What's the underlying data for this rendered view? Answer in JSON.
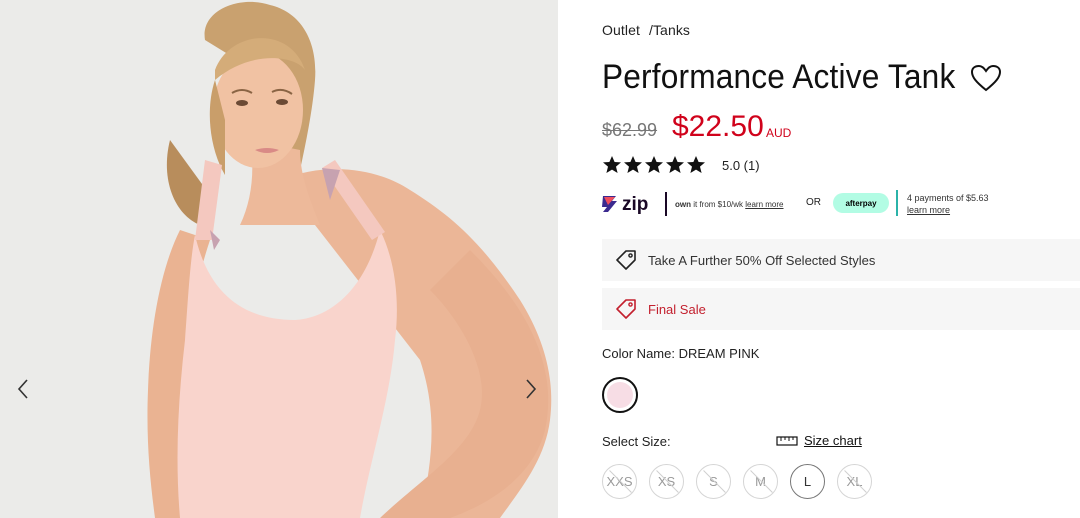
{
  "breadcrumb": {
    "category": "Outlet",
    "separator": "/",
    "subcategory": "Tanks"
  },
  "product": {
    "title": "Performance Active Tank",
    "original_price": "$62.99",
    "sale_price": "$22.50",
    "currency": "AUD",
    "rating_text": "5.0 (1)",
    "stars": 5
  },
  "payments": {
    "zip": {
      "logo": "zip",
      "text_bold": "own",
      "text": " it from $10/wk ",
      "link": "learn more"
    },
    "or": "OR",
    "afterpay": {
      "logo": "afterpay",
      "line1": "4 payments of $5.63",
      "link": "learn more"
    }
  },
  "promos": [
    {
      "icon": "tag-icon",
      "text": "Take A Further 50% Off Selected Styles"
    },
    {
      "icon": "tag-icon",
      "text": "Final Sale"
    }
  ],
  "color": {
    "label": "Color Name: DREAM PINK",
    "swatch_color": "#f7dde5"
  },
  "size": {
    "label": "Select Size:",
    "chart_link": "Size chart",
    "options": [
      {
        "label": "XXS",
        "available": false
      },
      {
        "label": "XS",
        "available": false
      },
      {
        "label": "S",
        "available": false
      },
      {
        "label": "M",
        "available": false
      },
      {
        "label": "L",
        "available": true
      },
      {
        "label": "XL",
        "available": false
      }
    ]
  },
  "gallery": {
    "prev_icon": "chevron-left-icon",
    "next_icon": "chevron-right-icon"
  },
  "colors": {
    "sale_red": "#d0021b",
    "afterpay_mint": "#b2fce4",
    "promo_bg": "#f6f6f6"
  }
}
